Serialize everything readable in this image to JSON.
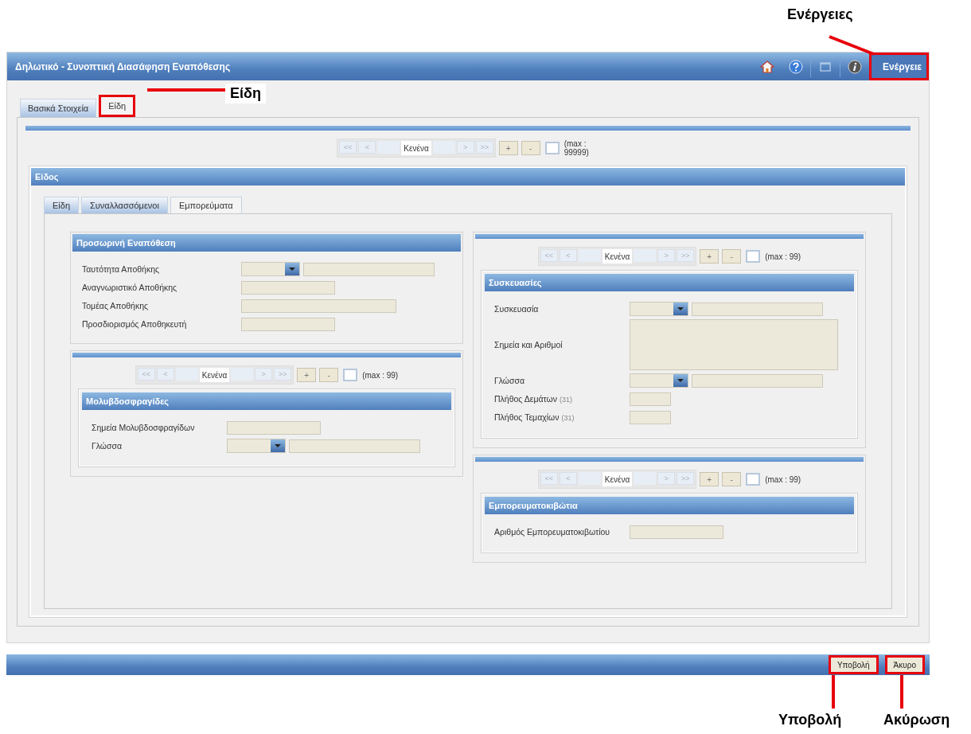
{
  "window": {
    "title": "Δηλωτικό - Συνοπτική Διασάφηση Εναπόθεσης",
    "toolbar": [
      {
        "kind": "home"
      },
      {
        "kind": "help"
      },
      {
        "kind": "window"
      },
      {
        "kind": "info"
      }
    ],
    "actions": {
      "label": "Ενέργειε",
      "highlighted": true
    }
  },
  "tabs": [
    {
      "label": "Βασικά Στοιχεία",
      "selected": false,
      "highlighted": false
    },
    {
      "label": "Είδη",
      "selected": true,
      "highlighted": true
    }
  ],
  "pager": {
    "nav": [
      "<<",
      "<"
    ],
    "current": "Κενένα",
    "nav_next": [
      ">",
      ">>"
    ],
    "actions": [
      "+",
      "-"
    ],
    "max": "(max : 99999)"
  },
  "item": {
    "title": "Είδος",
    "tabs": [
      {
        "label": "Είδη",
        "selected": false
      },
      {
        "label": "Συναλλασσόμενοι",
        "selected": false
      },
      {
        "label": "Εμπορεύματα",
        "selected": true
      }
    ],
    "left": [
      {
        "title": "Προσωρινή Εναπόθεση",
        "fields": [
          {
            "label": "Ταυτότητα Αποθήκης",
            "kind": "combo"
          },
          {
            "label": "Αναγνωριστικό Αποθήκης",
            "kind": "medium"
          },
          {
            "label": "Τομέας Αποθήκης",
            "kind": "long"
          },
          {
            "label": "Προσδιορισμός Αποθηκευτή",
            "kind": "medium"
          }
        ]
      },
      {
        "pager": {
          "nav": [
            "<<",
            "<"
          ],
          "current": "Κενένα",
          "nav_next": [
            ">",
            ">>"
          ],
          "actions": [
            "+",
            "-"
          ],
          "max": "(max : 99)"
        },
        "title": "Μολυβδοσφραγίδες",
        "fields": [
          {
            "label": "Σημεία Μολυβδοσφραγίδων",
            "kind": "medium"
          },
          {
            "label": "Γλώσσα",
            "kind": "combo"
          }
        ]
      }
    ],
    "right": [
      {
        "pager": {
          "nav": [
            "<<",
            "<"
          ],
          "current": "Κενένα",
          "nav_next": [
            ">",
            ">>"
          ],
          "actions": [
            "+",
            "-"
          ],
          "max": "(max : 99)"
        },
        "title": "Συσκευασίες",
        "fields": [
          {
            "label": "Συσκευασία",
            "kind": "combo"
          },
          {
            "label": "Σημεία και Αριθμοί",
            "kind": "area"
          },
          {
            "label": "Γλώσσα",
            "kind": "combo"
          },
          {
            "label": "Πλήθος Δεμάτων",
            "note": "(31)",
            "kind": "short"
          },
          {
            "label": "Πλήθος Τεμαχίων",
            "note": "(31)",
            "kind": "short"
          }
        ]
      },
      {
        "pager": {
          "nav": [
            "<<",
            "<"
          ],
          "current": "Κενένα",
          "nav_next": [
            ">",
            ">>"
          ],
          "actions": [
            "+",
            "-"
          ],
          "max": "(max : 99)"
        },
        "title": "Εμπορευματοκιβώτια",
        "fields": [
          {
            "label": "Αριθμός Εμπορευματοκιβωτίου",
            "kind": "medium"
          }
        ]
      }
    ]
  },
  "buttons": [
    {
      "label": "Υποβολή",
      "highlighted": true
    },
    {
      "label": "Άκυρο",
      "highlighted": true
    }
  ],
  "callouts": [
    {
      "label": "Ενέργειες"
    },
    {
      "label": "Είδη"
    },
    {
      "label": "Υποβολή"
    },
    {
      "label": "Ακύρωση"
    }
  ]
}
